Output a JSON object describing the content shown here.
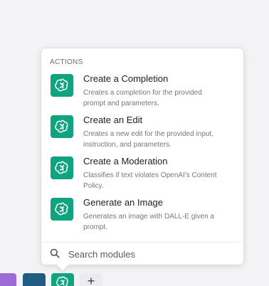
{
  "popover": {
    "section_title": "ACTIONS",
    "actions": [
      {
        "title": "Create a Completion",
        "description": "Creates a completion for the provided prompt and parameters.",
        "icon": "openai-icon"
      },
      {
        "title": "Create an Edit",
        "description": "Creates a new edit for the provided input, instruction, and parameters.",
        "icon": "openai-icon"
      },
      {
        "title": "Create a Moderation",
        "description": "Classifies if text violates OpenAI's Content Policy.",
        "icon": "openai-icon"
      },
      {
        "title": "Generate an Image",
        "description": "Generates an image with DALL-E given a prompt.",
        "icon": "openai-icon"
      }
    ],
    "search": {
      "placeholder": "Search modules",
      "value": ""
    }
  },
  "dock": {
    "add_label": "+"
  },
  "colors": {
    "openai_green": "#10a37f",
    "background": "#f3f3f5"
  }
}
